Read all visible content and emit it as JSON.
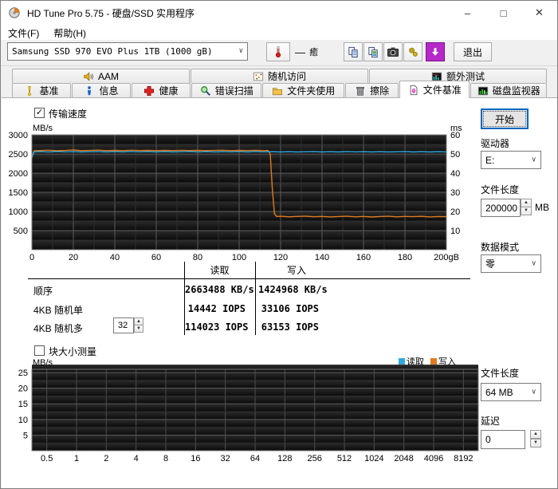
{
  "window": {
    "title": "HD Tune Pro 5.75 - 硬盘/SSD 实用程序",
    "min": "–",
    "max": "□",
    "close": "✕"
  },
  "menu": {
    "file": "文件(F)",
    "help": "帮助(H)"
  },
  "toolbar": {
    "drive": "Samsung SSD 970 EVO Plus 1TB (1000 gB)",
    "temp_dash": "—",
    "temp_unit": "癒",
    "exit": "退出"
  },
  "tabs": {
    "row1": [
      {
        "label": "AAM"
      },
      {
        "label": "随机访问"
      },
      {
        "label": "额外测试"
      }
    ],
    "row2": [
      {
        "label": "基准"
      },
      {
        "label": "信息"
      },
      {
        "label": "健康"
      },
      {
        "label": "错误扫描"
      },
      {
        "label": "文件夹使用"
      },
      {
        "label": "擦除"
      },
      {
        "label": "文件基准"
      },
      {
        "label": "磁盘监视器"
      }
    ]
  },
  "main": {
    "transfer_checkbox": "传输速度",
    "block_checkbox": "块大小测量",
    "check_glyph": "✓"
  },
  "controls": {
    "start": "开始",
    "drive_label": "驱动器",
    "drive_value": "E:",
    "file_length_label": "文件长度",
    "file_length_value": "200000",
    "file_length_unit": "MB",
    "data_pattern_label": "数据模式",
    "data_pattern_value": "零"
  },
  "controls2": {
    "file_length_label": "文件长度",
    "file_length_value": "64 MB",
    "latency_label": "延迟",
    "latency_value": "0"
  },
  "results": {
    "col_read": "读取",
    "col_write": "写入",
    "rows": [
      {
        "label": "顺序",
        "read": "2663488 KB/s",
        "write": "1424968 KB/s"
      },
      {
        "label": "4KB 随机单",
        "read": "14442 IOPS",
        "write": "33106 IOPS"
      },
      {
        "label": "4KB 随机多",
        "qd": "32",
        "read": "114023 IOPS",
        "write": "63153 IOPS"
      }
    ]
  },
  "legend": {
    "read_label": "读取",
    "write_label": "写入",
    "read_color": "#30a8dc",
    "write_color": "#e07b1f"
  },
  "chart_data": [
    {
      "type": "line",
      "title": "传输速度",
      "ylabel_left": "MB/s",
      "ylabel_right": "ms",
      "xlim": [
        0,
        200
      ],
      "ylim": [
        0,
        3000
      ],
      "ylim_right": [
        0,
        60
      ],
      "x_minor": 10,
      "x_major": 20,
      "y_minor": 250,
      "y_major": 500,
      "x_ticks": [
        {
          "v": 0,
          "t": "0"
        },
        {
          "v": 20,
          "t": "20"
        },
        {
          "v": 40,
          "t": "40"
        },
        {
          "v": 60,
          "t": "60"
        },
        {
          "v": 80,
          "t": "80"
        },
        {
          "v": 100,
          "t": "100"
        },
        {
          "v": 120,
          "t": "120"
        },
        {
          "v": 140,
          "t": "140"
        },
        {
          "v": 160,
          "t": "160"
        },
        {
          "v": 180,
          "t": "180"
        },
        {
          "v": 200,
          "t": "200gB"
        }
      ],
      "y_ticks_left": [
        {
          "v": 3000,
          "t": "3000"
        },
        {
          "v": 2500,
          "t": "2500"
        },
        {
          "v": 2000,
          "t": "2000"
        },
        {
          "v": 1500,
          "t": "1500"
        },
        {
          "v": 1000,
          "t": "1000"
        },
        {
          "v": 500,
          "t": "500"
        }
      ],
      "y_ticks_right": [
        {
          "v": 60,
          "t": "60"
        },
        {
          "v": 50,
          "t": "50"
        },
        {
          "v": 40,
          "t": "40"
        },
        {
          "v": 30,
          "t": "30"
        },
        {
          "v": 20,
          "t": "20"
        },
        {
          "v": 10,
          "t": "10"
        }
      ],
      "series": [
        {
          "name": "写入",
          "color": "#e07b1f",
          "points": [
            [
              0,
              2400
            ],
            [
              1,
              2585
            ],
            [
              4,
              2590
            ],
            [
              8,
              2598
            ],
            [
              12,
              2586
            ],
            [
              16,
              2592
            ],
            [
              20,
              2605
            ],
            [
              24,
              2588
            ],
            [
              28,
              2592
            ],
            [
              32,
              2600
            ],
            [
              36,
              2588
            ],
            [
              40,
              2594
            ],
            [
              44,
              2588
            ],
            [
              48,
              2598
            ],
            [
              52,
              2590
            ],
            [
              56,
              2594
            ],
            [
              60,
              2587
            ],
            [
              64,
              2593
            ],
            [
              68,
              2588
            ],
            [
              72,
              2596
            ],
            [
              76,
              2590
            ],
            [
              80,
              2594
            ],
            [
              84,
              2587
            ],
            [
              88,
              2592
            ],
            [
              92,
              2598
            ],
            [
              96,
              2588
            ],
            [
              100,
              2593
            ],
            [
              104,
              2589
            ],
            [
              108,
              2596
            ],
            [
              110,
              2590
            ],
            [
              112,
              2588
            ],
            [
              114,
              2592
            ],
            [
              115,
              2500
            ],
            [
              116,
              1600
            ],
            [
              117,
              950
            ],
            [
              118,
              866
            ],
            [
              120,
              872
            ],
            [
              124,
              858
            ],
            [
              128,
              868
            ],
            [
              132,
              874
            ],
            [
              136,
              860
            ],
            [
              140,
              869
            ],
            [
              144,
              856
            ],
            [
              148,
              866
            ],
            [
              152,
              873
            ],
            [
              156,
              859
            ],
            [
              160,
              868
            ],
            [
              164,
              855
            ],
            [
              168,
              867
            ],
            [
              172,
              872
            ],
            [
              176,
              858
            ],
            [
              180,
              869
            ],
            [
              184,
              862
            ],
            [
              188,
              871
            ],
            [
              192,
              857
            ],
            [
              196,
              867
            ],
            [
              200,
              862
            ]
          ]
        },
        {
          "name": "读取",
          "color": "#30a8dc",
          "points": [
            [
              0,
              2420
            ],
            [
              1,
              2552
            ],
            [
              4,
              2558
            ],
            [
              8,
              2552
            ],
            [
              12,
              2560
            ],
            [
              16,
              2554
            ],
            [
              20,
              2559
            ],
            [
              24,
              2552
            ],
            [
              28,
              2557
            ],
            [
              32,
              2561
            ],
            [
              36,
              2553
            ],
            [
              40,
              2558
            ],
            [
              44,
              2552
            ],
            [
              48,
              2560
            ],
            [
              52,
              2554
            ],
            [
              56,
              2558
            ],
            [
              60,
              2552
            ],
            [
              64,
              2559
            ],
            [
              68,
              2553
            ],
            [
              72,
              2557
            ],
            [
              76,
              2561
            ],
            [
              80,
              2553
            ],
            [
              84,
              2558
            ],
            [
              88,
              2552
            ],
            [
              92,
              2559
            ],
            [
              96,
              2554
            ],
            [
              100,
              2558
            ],
            [
              104,
              2552
            ],
            [
              108,
              2560
            ],
            [
              112,
              2554
            ],
            [
              116,
              2558
            ],
            [
              120,
              2552
            ],
            [
              124,
              2559
            ],
            [
              128,
              2553
            ],
            [
              132,
              2557
            ],
            [
              136,
              2561
            ],
            [
              140,
              2553
            ],
            [
              144,
              2558
            ],
            [
              148,
              2552
            ],
            [
              152,
              2560
            ],
            [
              156,
              2554
            ],
            [
              160,
              2558
            ],
            [
              164,
              2552
            ],
            [
              168,
              2559
            ],
            [
              172,
              2553
            ],
            [
              176,
              2557
            ],
            [
              180,
              2561
            ],
            [
              184,
              2553
            ],
            [
              188,
              2558
            ],
            [
              192,
              2552
            ],
            [
              196,
              2559
            ],
            [
              200,
              2555
            ]
          ]
        }
      ]
    },
    {
      "type": "line",
      "title": "块大小测量",
      "ylabel_left": "MB/s",
      "x_mode": "even",
      "xlim": [
        0,
        15
      ],
      "ylim": [
        0,
        26
      ],
      "y_minor": 2.5,
      "y_major": 5,
      "x_ticks": [
        {
          "t": "0.5"
        },
        {
          "t": "1"
        },
        {
          "t": "2"
        },
        {
          "t": "4"
        },
        {
          "t": "8"
        },
        {
          "t": "16"
        },
        {
          "t": "32"
        },
        {
          "t": "64"
        },
        {
          "t": "128"
        },
        {
          "t": "256"
        },
        {
          "t": "512"
        },
        {
          "t": "1024"
        },
        {
          "t": "2048"
        },
        {
          "t": "4096"
        },
        {
          "t": "8192"
        }
      ],
      "y_ticks_left": [
        {
          "v": 25,
          "t": "25"
        },
        {
          "v": 20,
          "t": "20"
        },
        {
          "v": 15,
          "t": "15"
        },
        {
          "v": 10,
          "t": "10"
        },
        {
          "v": 5,
          "t": "5"
        }
      ],
      "series": []
    }
  ]
}
